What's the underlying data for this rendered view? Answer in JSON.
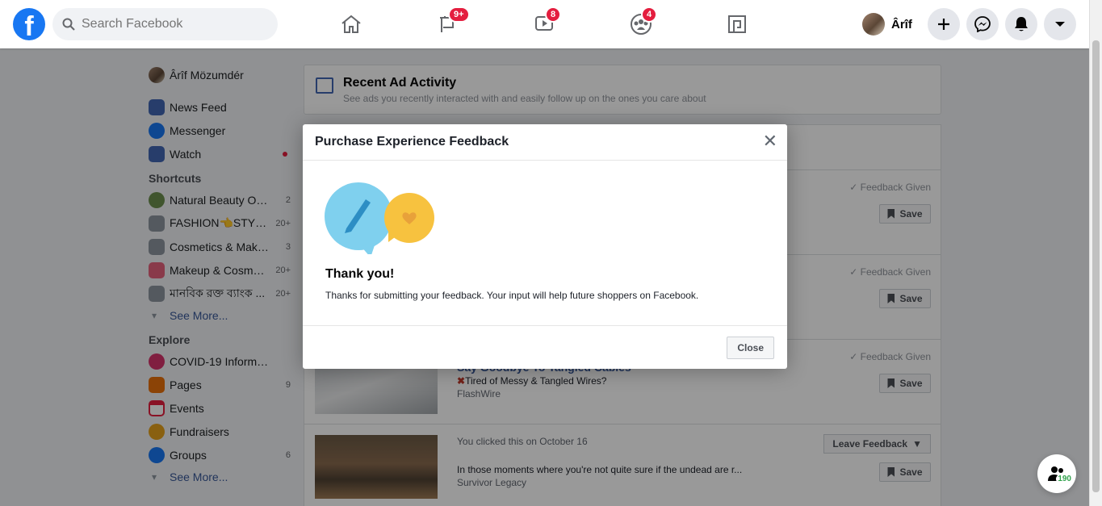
{
  "topbar": {
    "logo": "f",
    "search_placeholder": "Search Facebook",
    "badges": {
      "pages": "9+",
      "watch": "8",
      "groups": "4"
    },
    "profile_name": "Ârîf"
  },
  "sidebar": {
    "profile": "Ârîf Mözumdér",
    "main_items": [
      {
        "label": "News Feed",
        "count": ""
      },
      {
        "label": "Messenger",
        "count": ""
      },
      {
        "label": "Watch",
        "count": ""
      }
    ],
    "shortcuts_heading": "Shortcuts",
    "shortcuts": [
      {
        "label": "Natural Beauty Of ...",
        "count": "2"
      },
      {
        "label": "FASHION👈STYL...",
        "count": "20+"
      },
      {
        "label": "Cosmetics & Make...",
        "count": "3"
      },
      {
        "label": "Makeup & Cosmeti...",
        "count": "20+"
      },
      {
        "label": "মানবিক রক্ত ব্যাংক ...",
        "count": "20+"
      }
    ],
    "see_more_1": "See More...",
    "explore_heading": "Explore",
    "explore": [
      {
        "label": "COVID-19 Informat...",
        "count": ""
      },
      {
        "label": "Pages",
        "count": "9"
      },
      {
        "label": "Events",
        "count": ""
      },
      {
        "label": "Fundraisers",
        "count": ""
      },
      {
        "label": "Groups",
        "count": "6"
      }
    ],
    "see_more_2": "See More..."
  },
  "main": {
    "header_title": "Recent Ad Activity",
    "header_subtitle": "See ads you recently interacted with and easily follow up on the ones you care about",
    "feedback_given": "Feedback Given",
    "save": "Save",
    "leave_feedback": "Leave Feedback",
    "ad3": {
      "title": "Say Goodbye To Tangled Cables",
      "line": "Tired of Messy & Tangled Wires?",
      "source": "FlashWire"
    },
    "ad4": {
      "clicked": "You clicked this on October 16",
      "line": "In those moments where you're not quite sure if the undead are r...",
      "source": "Survivor Legacy"
    }
  },
  "modal": {
    "title": "Purchase Experience Feedback",
    "heading": "Thank you!",
    "message": "Thanks for submitting your feedback. Your input will help future shoppers on Facebook.",
    "close": "Close"
  },
  "floating": {
    "count": "190"
  }
}
